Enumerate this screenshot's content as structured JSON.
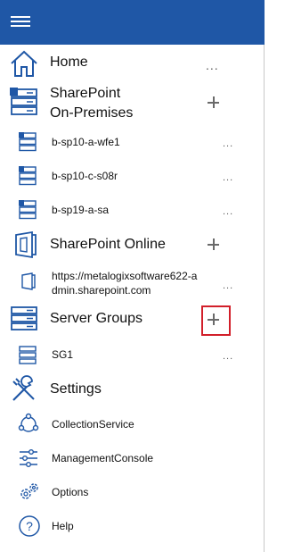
{
  "nav": {
    "home": {
      "label": "Home",
      "more": "..."
    },
    "sp_onprem": {
      "label_line1": "SharePoint",
      "label_line2": "On-Premises",
      "add": "+",
      "items": [
        {
          "label": "b-sp10-a-wfe1",
          "more": "..."
        },
        {
          "label": "b-sp10-c-s08r",
          "more": "..."
        },
        {
          "label": "b-sp19-a-sa",
          "more": "..."
        }
      ]
    },
    "sp_online": {
      "label": "SharePoint Online",
      "add": "+",
      "items": [
        {
          "label_line1": "https://metalogixsoftware622-a",
          "label_line2": "dmin.sharepoint.com",
          "more": "..."
        }
      ]
    },
    "server_groups": {
      "label": "Server Groups",
      "add": "+",
      "items": [
        {
          "label": "SG1",
          "more": "..."
        }
      ]
    },
    "settings": {
      "label": "Settings",
      "items": [
        {
          "label": "CollectionService"
        },
        {
          "label": "ManagementConsole"
        },
        {
          "label": "Options"
        },
        {
          "label": "Help"
        }
      ]
    }
  },
  "colors": {
    "topbar": "#1f57a6",
    "icon_blue": "#1f57a6",
    "highlight": "#d21f2a"
  },
  "icons": [
    "hamburger-icon",
    "home-icon",
    "server-icon",
    "sharepoint-online-icon",
    "server-group-icon",
    "settings-icon",
    "collection-service-icon",
    "sliders-icon",
    "gears-icon",
    "help-icon"
  ]
}
